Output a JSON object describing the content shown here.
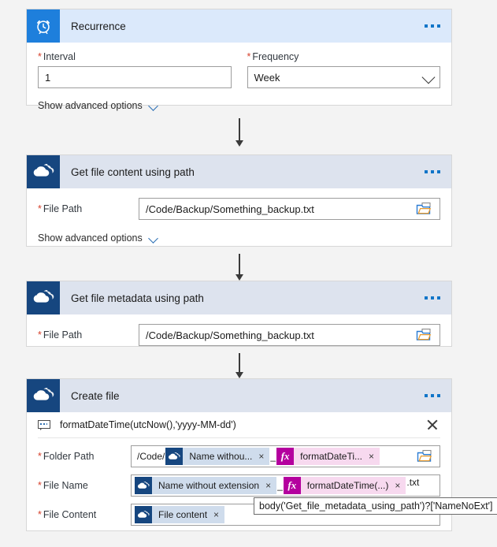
{
  "flow": {
    "cards": [
      {
        "id": "recurrence",
        "title": "Recurrence",
        "icon": "alarm-clock-icon",
        "menu": "more-options-ellipsis",
        "fields": [
          {
            "label": "Interval",
            "value": "1",
            "type": "text"
          },
          {
            "label": "Frequency",
            "value": "Week",
            "type": "dropdown"
          }
        ],
        "advanced_label": "Show advanced options"
      },
      {
        "id": "get-file-content-using-path",
        "title": "Get file content using path",
        "icon": "onedrive-cloud-icon",
        "menu": "more-options-ellipsis",
        "fields": [
          {
            "label": "File Path",
            "value": "/Code/Backup/Something_backup.txt",
            "type": "path"
          }
        ],
        "advanced_label": "Show advanced options"
      },
      {
        "id": "get-file-metadata-using-path",
        "title": "Get file metadata using path",
        "icon": "onedrive-cloud-icon",
        "menu": "more-options-ellipsis",
        "fields": [
          {
            "label": "File Path",
            "value": "/Code/Backup/Something_backup.txt",
            "type": "path"
          }
        ]
      },
      {
        "id": "create-file",
        "title": "Create file",
        "icon": "onedrive-cloud-icon",
        "menu": "more-options-ellipsis",
        "comment": "formatDateTime(utcNow(),'yyyy-MM-dd')",
        "token_rows": [
          {
            "label": "Folder Path",
            "prefix": "/Code/",
            "tokens": [
              {
                "kind": "dynamic",
                "text": "Name withou..."
              },
              {
                "kind": "function",
                "text": "formatDateTi..."
              }
            ],
            "separator": "_",
            "suffix": "",
            "picker": true
          },
          {
            "label": "File Name",
            "prefix": "",
            "tokens": [
              {
                "kind": "dynamic",
                "text": "Name without extension"
              },
              {
                "kind": "function",
                "text": "formatDateTime(...)"
              }
            ],
            "separator": "_",
            "suffix": ".txt",
            "picker": false
          },
          {
            "label": "File Content",
            "prefix": "",
            "tokens": [
              {
                "kind": "dynamic",
                "text": "File content"
              }
            ],
            "separator": "",
            "suffix": "",
            "picker": false
          }
        ],
        "tooltip": "body('Get_file_metadata_using_path')?['NameNoExt']"
      }
    ]
  },
  "colors": {
    "recurrence_header": "#dbe9fb",
    "onedrive_header": "#dde3ee",
    "recurrence_icon_bg": "#1e7fdc",
    "onedrive_icon_bg": "#16467f",
    "dynamic_token_bg": "#cfdcec",
    "function_token_bg": "#f7d9ef",
    "function_icon_bg": "#b4009e",
    "required_star": "#d6402b",
    "accent_link": "#1075c8",
    "page_bg": "#f3f3f3"
  },
  "icons": {
    "ellipsis": "more-options-ellipsis",
    "close": "close-icon",
    "chevron": "chevron-down-icon",
    "folder_picker": "folder-picker-icon",
    "comment": "comment-bubble-icon",
    "remove_token": "×"
  }
}
